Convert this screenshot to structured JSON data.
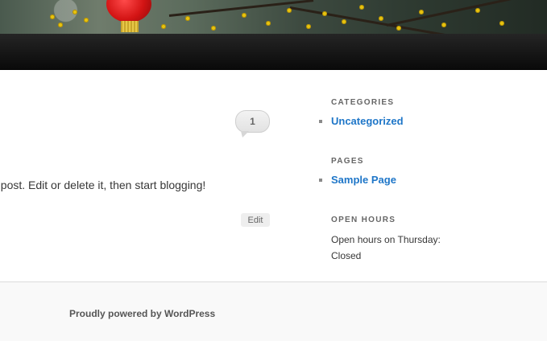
{
  "post": {
    "comment_count": "1",
    "excerpt": "st post. Edit or delete it, then start blogging!",
    "edit_label": "Edit"
  },
  "sidebar": {
    "categories": {
      "title": "CATEGORIES",
      "items": [
        "Uncategorized"
      ]
    },
    "pages": {
      "title": "PAGES",
      "items": [
        "Sample Page"
      ]
    },
    "open_hours": {
      "title": "OPEN HOURS",
      "text": "Open hours on Thursday: Closed"
    }
  },
  "footer": {
    "credit": "Proudly powered by WordPress"
  },
  "colors": {
    "link": "#1e76c8",
    "nav_bar": "#111111",
    "lantern": "#d31414",
    "blossom": "#e8c40f"
  }
}
